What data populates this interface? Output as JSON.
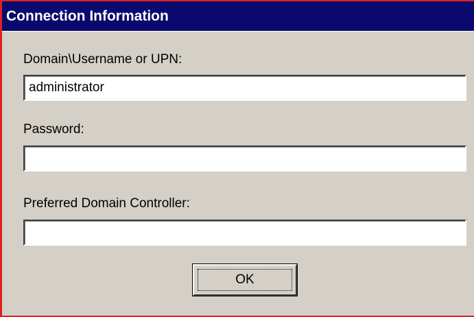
{
  "window": {
    "title": "Connection Information"
  },
  "form": {
    "username_label": "Domain\\Username or UPN:",
    "username_value": "administrator",
    "password_label": "Password:",
    "password_value": "",
    "dc_label": "Preferred Domain Controller:",
    "dc_value": ""
  },
  "buttons": {
    "ok_label": "OK"
  },
  "colors": {
    "titlebar": "#0a0a6e",
    "dialog_face": "#d4d0c8",
    "outer_border": "#e02020"
  }
}
